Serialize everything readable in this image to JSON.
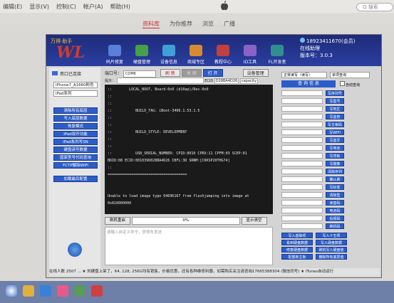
{
  "host": {
    "menus": [
      "编辑(E)",
      "显示(V)",
      "控制(C)",
      "帐户(A)",
      "帮助(H)"
    ],
    "tabs": [
      "资料库",
      "为你推荐",
      "浏览",
      "广播"
    ],
    "search_placeholder": "Q 搜索"
  },
  "app": {
    "logo_cn": "万得·助手",
    "logo": "WL",
    "nav": [
      {
        "label": "码片修复",
        "icon": "chip-icon",
        "color": "#5a7fd8"
      },
      {
        "label": "硬盘管理",
        "icon": "disk-icon",
        "color": "#46a04a"
      },
      {
        "label": "设备信息",
        "icon": "device-icon",
        "color": "#3fa0d8"
      },
      {
        "label": "商城专区",
        "icon": "cart-icon",
        "color": "#d88a30"
      },
      {
        "label": "教程中心",
        "icon": "book-icon",
        "color": "#c04040"
      },
      {
        "label": "ID工具",
        "icon": "tools-icon",
        "color": "#8a62c8"
      },
      {
        "label": "FL开发者",
        "icon": "shield-icon",
        "color": "#2f8f8f"
      },
      {
        "label": "在线助理",
        "icon": "support-icon",
        "color": "#d8c030"
      }
    ],
    "user": {
      "phone": "18923411670(会员)",
      "version_label": "版本号：",
      "version": "3.0.3"
    },
    "left": {
      "heading": "串口已连接",
      "device_select": "iPhone7_A1660粉色",
      "series_select": "iPad系列",
      "buttons": [
        "清除所有底层",
        "写入底层数据",
        "恢复模式",
        "iPad双开功能",
        "iPad系列写SN",
        "硬盘读写数据",
        "国家型号代码查询",
        "FCTP解除WiFi",
        "加载最后配置"
      ]
    },
    "port": {
      "label": "端口号：",
      "value": "COM6",
      "open_btn": "刷 新",
      "close_btn": "关 闭",
      "connect_btn": "打 开",
      "device_mgr_btn": "设备管理",
      "hint_label": "提示：",
      "ecid_label": "ECID",
      "ecid_value": "D28BA4D26",
      "capacity_label": "capacity"
    },
    "console_lines": [
      "::        LOCAL_BOOT, Board-0x0 (d10ap)/Rev-0x0",
      "::",
      "::",
      "::           BUILD_TAG: iBoot-3406.1.53.1.5",
      "::",
      "::",
      "::           BUILD_STYLE: DEVELOPMENT",
      "::",
      "::",
      "::           USB_SERIAL_NUMBER: CPID:8010 CPRV:11 CPFM:03 SCEP:01",
      "BDID:08 ECID:001039D028BA4D26 IBFL:3D SRNM:[C6KSP20THG74]",
      "::",
      "=====================================",
      "",
      "",
      "Unable to load image type 64696167 from flashjumping into image at",
      "0x810000000"
    ],
    "progress": {
      "button": "刷机重启",
      "value": "0%",
      "clear_btn": "显示清空"
    },
    "input_placeholder": "请输入自定义命令，获得车发送",
    "right": {
      "mode_select": "正常读写（读写）",
      "single_select": "单项查询",
      "query_btn": "查 询 信 息",
      "auto_label": "自动查询",
      "side_btns": [
        "写序列号",
        "写型号",
        "写地区",
        "写监管",
        "写主板码",
        "写WIFI",
        "写蓝牙",
        "写电池",
        "写背板",
        "写摄像",
        "清除序列",
        "确认刷",
        "写标签",
        "清除型",
        "读基码",
        "电池码",
        "后视码",
        "刷机码"
      ],
      "bottom_btns": [
        "写入基础项",
        "写入十五项",
        "看到硬盘数据",
        "写入硬盘数据",
        "修复硬盘数据",
        "刷机写入硬盘值",
        "配置新主板",
        "删除所有底层值"
      ]
    },
    "status": "在线人数  2507   ...  ★ 刘硬盘上架了，64, 128, 256G均有销售，价格优惠，还有各种维修利器，如需购买关注请咨询17665388304  (微信同号)          ★ iTunes自动运行"
  },
  "taskbar": {
    "icons": [
      "start-icon",
      "folder-icon",
      "browser-icon",
      "itunes-icon",
      "app-icon",
      "app2-icon"
    ]
  }
}
